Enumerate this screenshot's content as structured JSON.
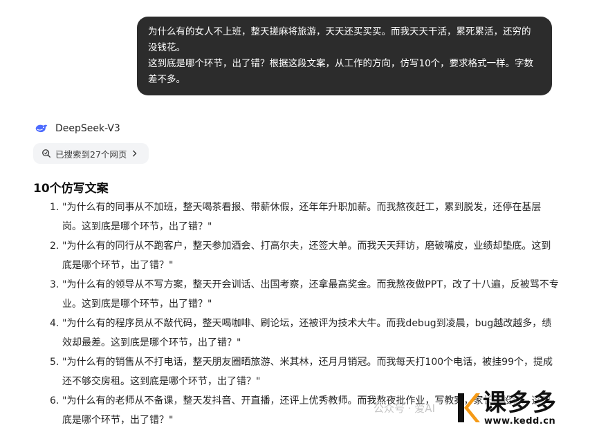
{
  "user_message": {
    "line1": "为什么有的女人不上班，整天搓麻将旅游，天天还买买买。而我天天干活，累死累活，还穷的没钱花。",
    "line2": "这到底是哪个环节，出了错？根据这段文案，从工作的方向，仿写10个，要求格式一样。字数差不多。"
  },
  "assistant": {
    "model_name": "DeepSeek-V3",
    "search_summary": "已搜索到27个网页",
    "section_title": "10个仿写文案",
    "items": [
      {
        "num": "1.",
        "text": "\"为什么有的同事从不加班，整天喝茶看报、带薪休假，还年年升职加薪。而我熬夜赶工，累到脱发，还停在基层岗。这到底是哪个环节，出了错？\""
      },
      {
        "num": "2.",
        "text": "\"为什么有的同行从不跑客户，整天参加酒会、打高尔夫，还签大单。而我天天拜访，磨破嘴皮，业绩却垫底。这到底是哪个环节，出了错？\""
      },
      {
        "num": "3.",
        "text": "\"为什么有的领导从不写方案，整天开会训话、出国考察，还拿最高奖金。而我熬夜做PPT，改了十八遍，反被骂不专业。这到底是哪个环节，出了错？\""
      },
      {
        "num": "4.",
        "text": "\"为什么有的程序员从不敲代码，整天喝咖啡、刷论坛，还被评为技术大牛。而我debug到凌晨，bug越改越多，绩效却最差。这到底是哪个环节，出了错？\""
      },
      {
        "num": "5.",
        "text": "\"为什么有的销售从不打电话，整天朋友圈晒旅游、米其林，还月月销冠。而我每天打100个电话，被挂99个，提成还不够交房租。这到底是哪个环节，出了错？\""
      },
      {
        "num": "6.",
        "text": "\"为什么有的老师从不备课，整天发抖音、开直播，还评上优秀教师。而我熬夜批作业，写教案，家长还投诉。这到底是哪个环节，出了错？\""
      }
    ]
  },
  "watermark": {
    "account": "公众号 · 爱AI",
    "brand": "课多多",
    "url": "www.kedd.cn"
  },
  "colors": {
    "bubble_bg": "#2c2c2c",
    "chip_bg": "#f3f4f6",
    "whale": "#4d6bfe",
    "logo_orange": "#f59a16"
  }
}
